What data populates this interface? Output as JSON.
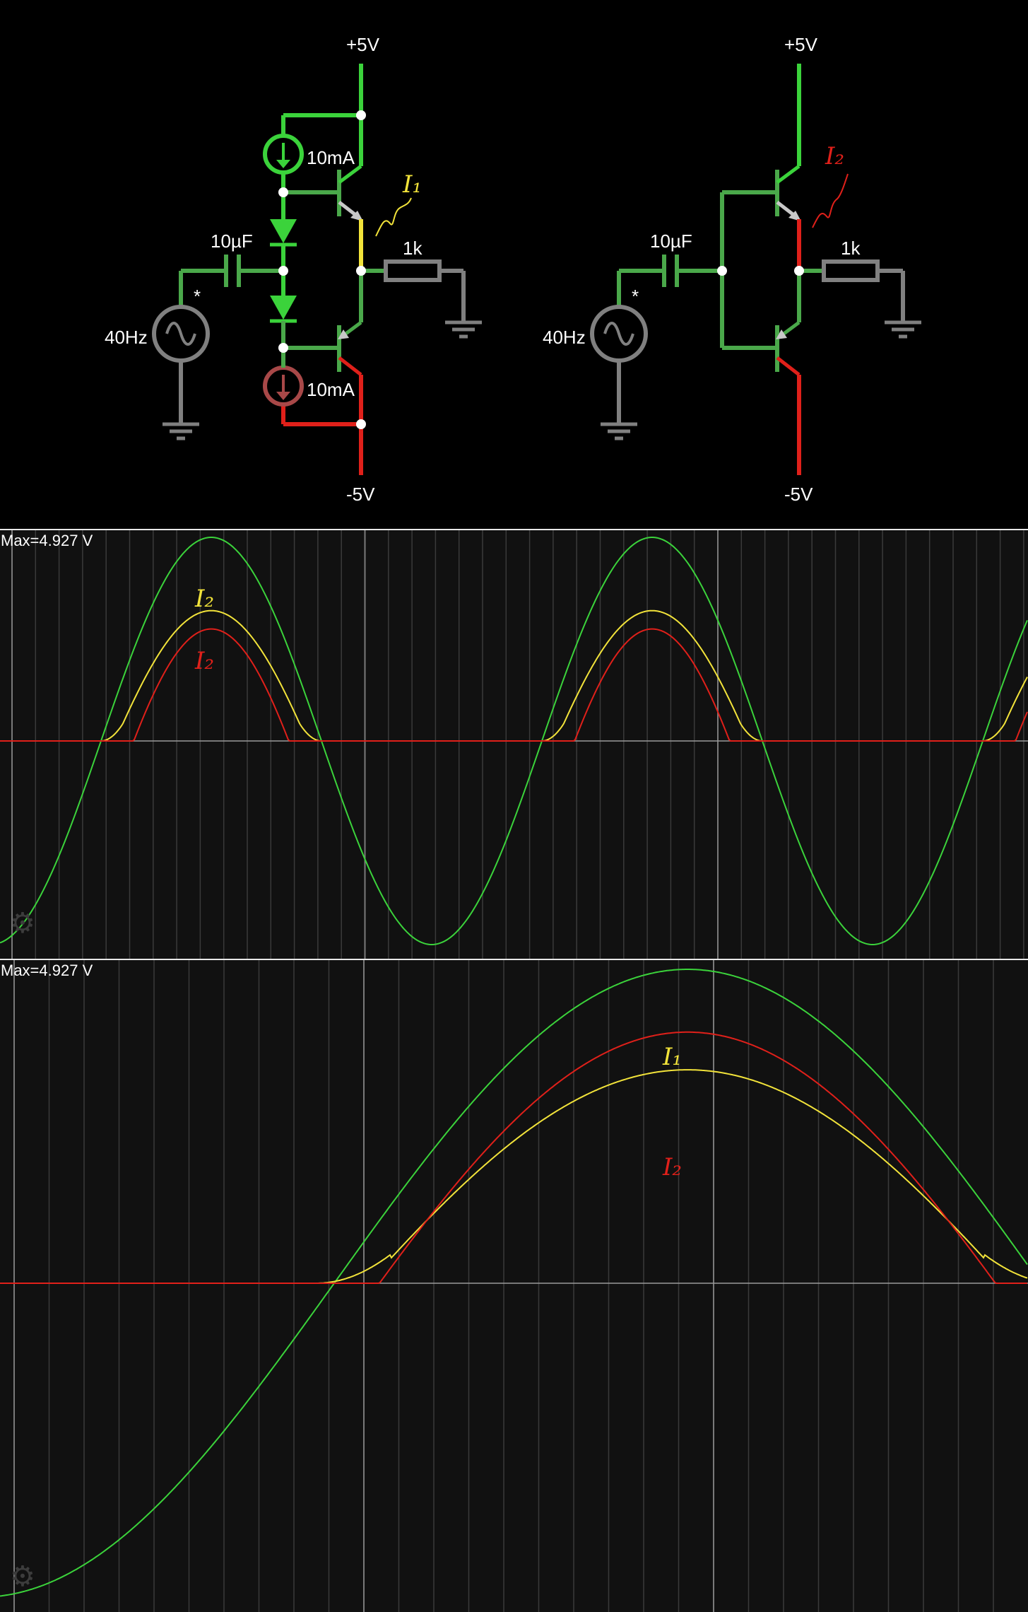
{
  "circuit": {
    "left": {
      "supply_top": "+5V",
      "supply_bottom": "-5V",
      "current_source_top": "10mA",
      "current_source_bottom": "10mA",
      "capacitor": "10µF",
      "resistor": "1k",
      "source_freq": "40Hz",
      "source_marker": "*",
      "annotation": "I₁"
    },
    "right": {
      "supply_top": "+5V",
      "supply_bottom": "-5V",
      "capacitor": "10µF",
      "resistor": "1k",
      "source_freq": "40Hz",
      "source_marker": "*",
      "annotation": "I₂"
    }
  },
  "scope1": {
    "max_label": "Max=4.927 V",
    "annotations": [
      "I₂",
      "I₂"
    ]
  },
  "scope2": {
    "max_label": "Max=4.927 V",
    "annotations": [
      "I₁",
      "I₂"
    ]
  },
  "colors": {
    "green": "#3bd33b",
    "yellow": "#f2e33a",
    "red": "#e0201a",
    "wire": "#4aa84a",
    "gray": "#808080",
    "background": "#000000",
    "scope_bg": "#111111"
  },
  "icons": [
    "gear-icon",
    "sine-source-icon",
    "ground-icon",
    "diode-icon",
    "current-source-icon"
  ]
}
